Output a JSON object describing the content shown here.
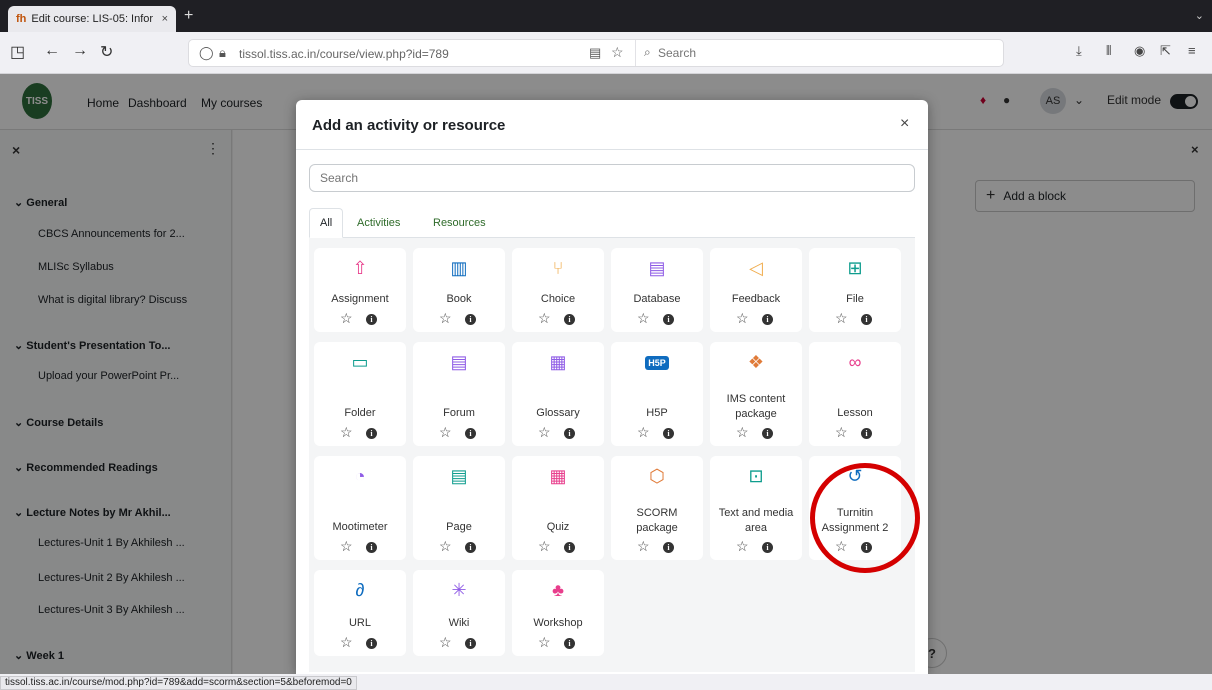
{
  "browser": {
    "tab_title": "Edit course: LIS-05: Infor",
    "tab_close": "×",
    "tab_favicon": "fh",
    "new_tab": "+",
    "tab_menu": "⌄",
    "url": "tissol.tiss.ac.in/course/view.php?id=789",
    "search_placeholder": "Search",
    "status_url": "tissol.tiss.ac.in/course/mod.php?id=789&add=scorm&section=5&beforemod=0"
  },
  "header": {
    "logo_text": "TISS",
    "nav": [
      "Home",
      "Dashboard",
      "My courses"
    ],
    "avatar_initials": "AS",
    "avatar_caret": "⌄",
    "edit_mode_label": "Edit mode",
    "edit_mode_on": true
  },
  "sidebar": {
    "close": "×",
    "kebab": "⋮",
    "rows": [
      {
        "type": "section",
        "label": "General"
      },
      {
        "type": "item",
        "label": "CBCS Announcements for 2..."
      },
      {
        "type": "item",
        "label": "MLISc Syllabus"
      },
      {
        "type": "item",
        "label": "What is digital library? Discuss"
      },
      {
        "type": "section",
        "label": "Student's Presentation To..."
      },
      {
        "type": "item",
        "label": "Upload your PowerPoint Pr..."
      },
      {
        "type": "section",
        "label": "Course Details"
      },
      {
        "type": "section",
        "label": "Recommended Readings"
      },
      {
        "type": "section",
        "label": "Lecture Notes by Mr Akhil..."
      },
      {
        "type": "item",
        "label": "Lectures-Unit 1 By Akhilesh ..."
      },
      {
        "type": "item",
        "label": "Lectures-Unit 2 By Akhilesh ..."
      },
      {
        "type": "item",
        "label": "Lectures-Unit 3 By Akhilesh ..."
      },
      {
        "type": "section",
        "label": "Week 1"
      }
    ]
  },
  "main": {
    "close": "×",
    "add_block_label": "Add a block",
    "help": "?"
  },
  "modal": {
    "title": "Add an activity or resource",
    "close": "×",
    "search_placeholder": "Search",
    "tabs": [
      "All",
      "Activities",
      "Resources"
    ],
    "active_tab": "All",
    "highlighted_item": "Turnitin Assignment 2",
    "items": [
      {
        "name": "Assignment",
        "icon": "assignment-icon",
        "glyph": "⇧",
        "color": "#e83e8c"
      },
      {
        "name": "Book",
        "icon": "book-icon",
        "glyph": "▥",
        "color": "#0f6cbf"
      },
      {
        "name": "Choice",
        "icon": "choice-icon",
        "glyph": "⑂",
        "color": "#f0ad4e"
      },
      {
        "name": "Database",
        "icon": "database-icon",
        "glyph": "▤",
        "color": "#8f5ce6"
      },
      {
        "name": "Feedback",
        "icon": "feedback-icon",
        "glyph": "◁",
        "color": "#f0ad4e"
      },
      {
        "name": "File",
        "icon": "file-icon",
        "glyph": "⊞",
        "color": "#0f9d8e"
      },
      {
        "name": "Folder",
        "icon": "folder-icon",
        "glyph": "▭",
        "color": "#0f9d8e"
      },
      {
        "name": "Forum",
        "icon": "forum-icon",
        "glyph": "▤",
        "color": "#8f5ce6"
      },
      {
        "name": "Glossary",
        "icon": "glossary-icon",
        "glyph": "▦",
        "color": "#8f5ce6"
      },
      {
        "name": "H5P",
        "icon": "h5p-icon",
        "glyph": "H5P",
        "color": "#0f6cbf"
      },
      {
        "name": "IMS content package",
        "icon": "ims-package-icon",
        "glyph": "❖",
        "color": "#e07b39"
      },
      {
        "name": "Lesson",
        "icon": "lesson-icon",
        "glyph": "∞",
        "color": "#e83e8c"
      },
      {
        "name": "Mootimeter",
        "icon": "mootimeter-icon",
        "glyph": "◔",
        "color": "#8f5ce6"
      },
      {
        "name": "Page",
        "icon": "page-icon",
        "glyph": "▤",
        "color": "#0f9d8e"
      },
      {
        "name": "Quiz",
        "icon": "quiz-icon",
        "glyph": "▦",
        "color": "#e83e8c"
      },
      {
        "name": "SCORM package",
        "icon": "scorm-icon",
        "glyph": "⬡",
        "color": "#e07b39"
      },
      {
        "name": "Text and media area",
        "icon": "text-media-icon",
        "glyph": "⊡",
        "color": "#0f9d8e"
      },
      {
        "name": "Turnitin Assignment 2",
        "icon": "turnitin-icon",
        "glyph": "↺",
        "color": "#0f6cbf"
      },
      {
        "name": "URL",
        "icon": "url-icon",
        "glyph": "∂",
        "color": "#0f6cbf"
      },
      {
        "name": "Wiki",
        "icon": "wiki-icon",
        "glyph": "✳",
        "color": "#8f5ce6"
      },
      {
        "name": "Workshop",
        "icon": "workshop-icon",
        "glyph": "♣",
        "color": "#e83e8c"
      }
    ]
  }
}
